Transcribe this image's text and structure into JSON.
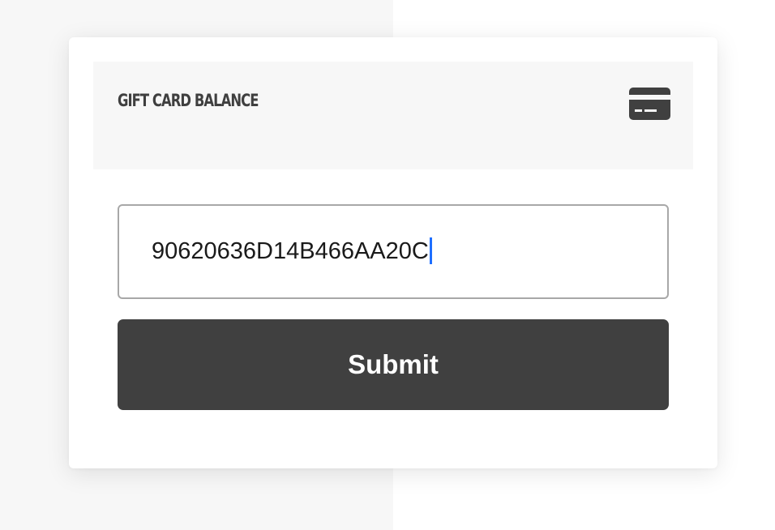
{
  "card": {
    "header": {
      "title": "GIFT CARD BALANCE",
      "icon": "credit-card-icon"
    },
    "form": {
      "gift_card_number": "90620636D14B466AA20C",
      "submit_label": "Submit"
    }
  },
  "colors": {
    "page_left_bg": "#f7f7f7",
    "page_right_bg": "#ffffff",
    "header_bg": "#f7f7f7",
    "header_text": "#3f3f3f",
    "button_bg": "#404040",
    "button_text": "#ffffff",
    "caret": "#1f6fff"
  }
}
